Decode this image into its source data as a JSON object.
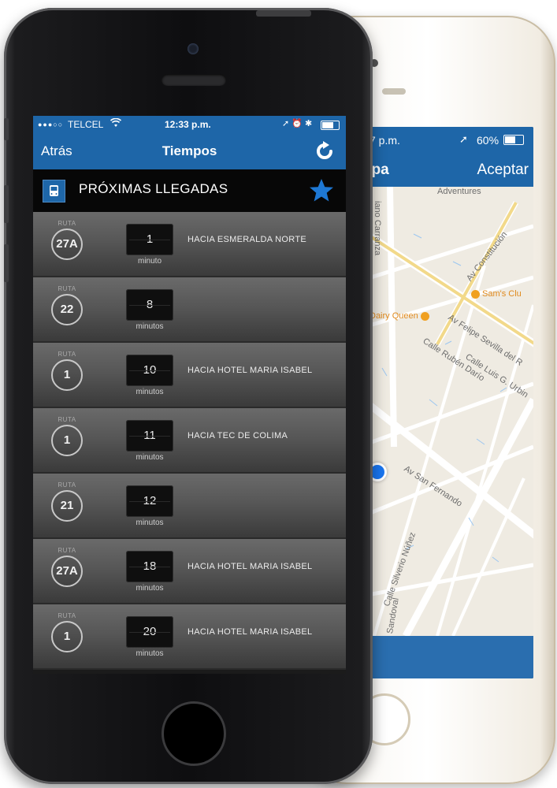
{
  "front": {
    "status": {
      "signal": "●●●○○",
      "carrier": "TELCEL",
      "time": "12:33 p.m.",
      "icons": "➚ ⏰ ✱"
    },
    "nav": {
      "back_label": "Atrás",
      "title": "Tiempos"
    },
    "section": {
      "heading": "PRÓXIMAS LLEGADAS"
    },
    "arrivals": [
      {
        "route_label": "RUTA",
        "route": "27A",
        "time": "1",
        "unit": "minuto",
        "destination": "HACIA ESMERALDA NORTE"
      },
      {
        "route_label": "RUTA",
        "route": "22",
        "time": "8",
        "unit": "minutos",
        "destination": ""
      },
      {
        "route_label": "RUTA",
        "route": "1",
        "time": "10",
        "unit": "minutos",
        "destination": "HACIA HOTEL MARIA ISABEL"
      },
      {
        "route_label": "RUTA",
        "route": "1",
        "time": "11",
        "unit": "minutos",
        "destination": "HACIA TEC DE COLIMA"
      },
      {
        "route_label": "RUTA",
        "route": "21",
        "time": "12",
        "unit": "minutos",
        "destination": ""
      },
      {
        "route_label": "RUTA",
        "route": "27A",
        "time": "18",
        "unit": "minutos",
        "destination": "HACIA HOTEL MARIA ISABEL"
      },
      {
        "route_label": "RUTA",
        "route": "1",
        "time": "20",
        "unit": "minutos",
        "destination": "HACIA HOTEL MARIA ISABEL"
      }
    ]
  },
  "back": {
    "status": {
      "time": "7 p.m.",
      "battery": "60%"
    },
    "nav": {
      "title": "apa",
      "accept_label": "Aceptar"
    },
    "map_labels": {
      "carranza": "iano Carranza",
      "constitucion": "Av Constitución",
      "sams": "Sam's Clu",
      "dairy": "Dairy Queen",
      "felipe": "Av Felipe Sevilla del R",
      "luis": "Calle Luis G. Urbin",
      "ruben": "Calle Rubén Darío",
      "fernando": "Av San Fernando",
      "silverio": "Calle Silverio Núñez",
      "sandoval": "Sandoval",
      "adventures": "Adventures"
    }
  },
  "colors": {
    "nav_blue": "#1e66a8",
    "row_gray": "#575757",
    "poi_orange": "#f0a020"
  }
}
